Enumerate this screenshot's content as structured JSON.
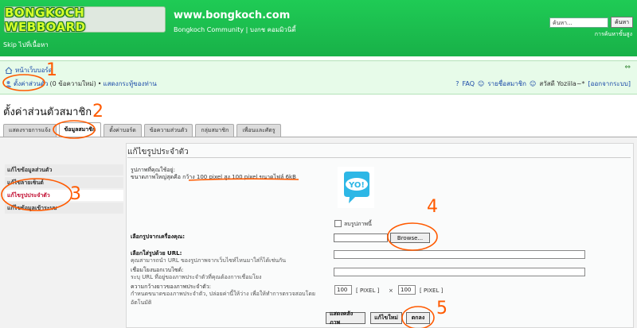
{
  "header": {
    "logo_text": "BONGKOCH WEBBOARD",
    "site_title": "www.bongkoch.com",
    "site_subtitle": "Bongkoch Community | บงกช คอมมิวนิตี้",
    "search_placeholder": "ค้นหา...",
    "search_button": "ค้นหา",
    "advanced_search": "การค้นหาขั้นสูง",
    "skip_link": "Skip ไปที่เนื้อหา"
  },
  "nav": {
    "home": "หน้าเว็บบอร์ด",
    "ucp": "ตั้งค่าส่วนตัว",
    "new_messages": "(0 ข้อความใหม่)",
    "separator": "•",
    "view_posts": "แสดงกระทู้ของท่าน",
    "faq": "FAQ",
    "members": "รายชื่อสมาชิก",
    "greeting": "สวัสดี Yoziila~*",
    "logout": "[ออกจากระบบ]"
  },
  "page_title": "ตั้งค่าส่วนตัวสมาชิก",
  "tabs": [
    {
      "label": "แสดงรายการแจ้ง"
    },
    {
      "label": "ข้อมูลสมาชิก"
    },
    {
      "label": "ตั้งค่าบอร์ด"
    },
    {
      "label": "ข้อความส่วนตัว"
    },
    {
      "label": "กลุ่มสมาชิก"
    },
    {
      "label": "เพื่อนและศัตรู"
    }
  ],
  "side_menu": [
    {
      "label": "แก้ไขข้อมูลส่วนตัว"
    },
    {
      "label": "แก้ไขลายเซ็นต์"
    },
    {
      "label": "แก้ไขรูปประจำตัว"
    },
    {
      "label": "แก้ไขข้อมูลเข้าระบบ"
    }
  ],
  "content": {
    "title": "แก้ไขรูปประจำตัว",
    "current_avatar_label": "รูปภาพที่คุณใช้อยู่:",
    "max_size_text": "ขนาดภาพใหญ่สุดคือ กว้าง 100 pixel สูง 100 pixel ขนาดไฟล์ 6kB",
    "avatar_text": "YO!",
    "delete_image": "ลบรูปภาพนี้",
    "upload_label": "เลือกรูปจากเครื่องคุณ:",
    "browse_button": "Browse...",
    "url_label": "เลือกใส่รูปด้วย URL:",
    "url_desc": "คุณสามารถนำ URL ของรูปภาพจากเว็บไซท์ไหนมาใส่ก็ได้เช่นกัน",
    "link_label": "เชื่อมโยงนอกเวบไซต์:",
    "link_desc": "ระบุ URL ที่อยู่ของภาพประจำตัวที่คุณต้องการเชื่อมโยง",
    "dims_label": "ความกว้างยาวของภาพประจำตัว:",
    "dims_desc": "กำหนดขนาดของภาพประจำตัว, ปล่อยค่านี้ให้ว่าง เพื่อให้ทำการตรวจสอบโดยอัตโนมัติ",
    "width_value": "100",
    "height_value": "100",
    "unit_label": "[ PIXEL ]",
    "times": "×"
  },
  "buttons": {
    "display_gallery": "แสดงคลังภาพ",
    "reset": "แก้ไขใหม่",
    "submit": "ตกลง"
  },
  "annotations": [
    "1",
    "2",
    "3",
    "4",
    "5"
  ],
  "colors": {
    "header_green": "#1fcb55",
    "nav_bg": "#e7fbe9",
    "annotation": "#ff5a00",
    "active_menu": "#c0082c"
  }
}
